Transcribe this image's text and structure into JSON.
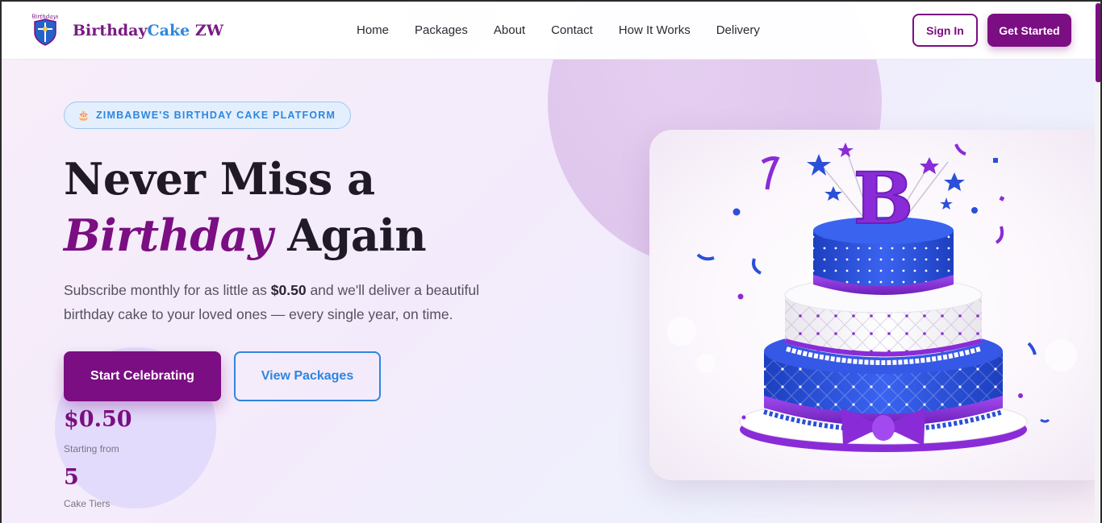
{
  "header": {
    "brand_part1": "Birthday",
    "brand_part2": "Cake",
    "brand_part3": " ZW",
    "nav": [
      "Home",
      "Packages",
      "About",
      "Contact",
      "How It Works",
      "Delivery"
    ],
    "signin_label": "Sign In",
    "get_started_label": "Get Started"
  },
  "hero": {
    "badge_icon": "cake-icon",
    "badge_text": "ZIMBABWE'S BIRTHDAY CAKE PLATFORM",
    "title_line1": "Never Miss a",
    "title_em": "Birthday",
    "title_rest": " Again",
    "lead_before": "Subscribe monthly for as little as ",
    "lead_price": "$0.50",
    "lead_after": " and we'll deliver a beautiful birthday cake to your loved ones — every single year, on time.",
    "primary_cta": "Start Celebrating",
    "secondary_cta": "View Packages"
  },
  "stats": [
    {
      "value": "$0.50",
      "label": "Starting from"
    },
    {
      "value": "5",
      "label": "Cake Tiers"
    }
  ],
  "cake_image": {
    "topper_letter": "B",
    "description_icon": "birthday-cake-illustration"
  },
  "colors": {
    "brand_purple": "#7b0e82",
    "brand_blue": "#2e86de",
    "cake_blue": "#2b4fd8",
    "cake_purple": "#8a2bd8"
  }
}
